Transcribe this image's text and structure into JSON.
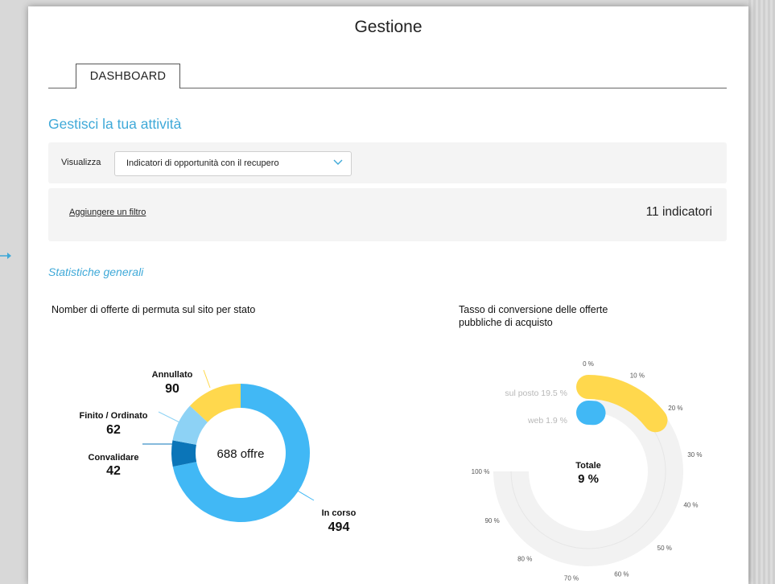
{
  "header": {
    "title": "Gestione"
  },
  "tabs": [
    {
      "label": "DASHBOARD",
      "active": true
    }
  ],
  "section": {
    "title": "Gestisci la tua attività"
  },
  "view": {
    "label": "Visualizza",
    "selected": "Indicatori di opportunità con il recupero"
  },
  "filter": {
    "add_label": "Aggiungere un filtro",
    "count_label": "11 indicatori"
  },
  "stats": {
    "title": "Statistiche generali"
  },
  "colors": {
    "accent": "#3fa9d8",
    "in_corso": "#41b8f5",
    "convalidare": "#0b75b8",
    "finito": "#8dd2f5",
    "annullato": "#ffd84d",
    "track": "#f2f2f2"
  },
  "chart1": {
    "title": "Nomber di offerte di permuta sul sito per stato",
    "center_label": "688 offre"
  },
  "chart2": {
    "title": "Tasso di conversione delle offerte pubbliche di acquisto",
    "center_title": "Totale",
    "center_value": "9 %"
  },
  "chart_data": [
    {
      "type": "pie",
      "title": "Nomber di offerte di permuta sul sito per stato",
      "total_label": "688 offre",
      "slices": [
        {
          "label": "In corso",
          "value": 494
        },
        {
          "label": "Convalidare",
          "value": 42
        },
        {
          "label": "Finito / Ordinato",
          "value": 62
        },
        {
          "label": "Annullato",
          "value": 90
        }
      ]
    },
    {
      "type": "radial-bar",
      "title": "Tasso di conversione delle offerte pubbliche di acquisto",
      "axis_ticks": [
        "0 %",
        "10 %",
        "20 %",
        "30 %",
        "40 %",
        "50 %",
        "60 %",
        "70 %",
        "80 %",
        "90 %",
        "100 %"
      ],
      "axis_range": [
        0,
        100
      ],
      "series": [
        {
          "name": "sul posto",
          "value": 19.5,
          "label": "sul posto 19.5 %"
        },
        {
          "name": "web",
          "value": 1.9,
          "label": "web 1.9 %"
        }
      ],
      "total": {
        "label": "Totale",
        "value": "9 %"
      }
    }
  ]
}
